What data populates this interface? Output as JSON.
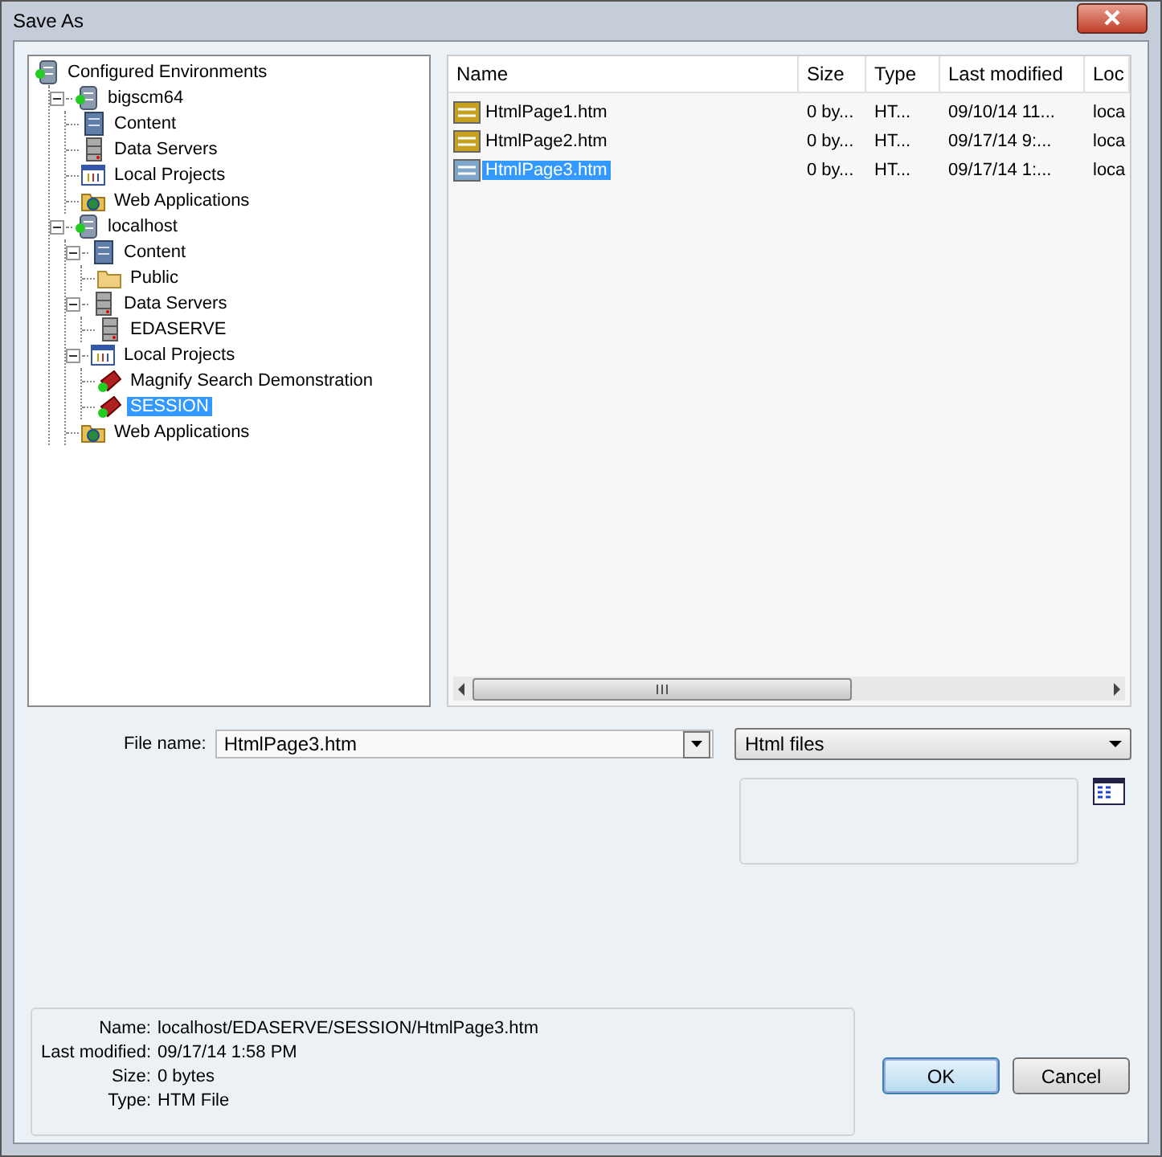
{
  "window": {
    "title": "Save As"
  },
  "tree": [
    {
      "label": "Configured Environments",
      "kind": "environments",
      "selected": false,
      "children": [
        {
          "label": "bigscm64",
          "kind": "server",
          "selected": false,
          "expanded": true,
          "children": [
            {
              "label": "Content",
              "kind": "content",
              "selected": false
            },
            {
              "label": "Data Servers",
              "kind": "dataservers",
              "selected": false
            },
            {
              "label": "Local Projects",
              "kind": "projects",
              "selected": false
            },
            {
              "label": "Web Applications",
              "kind": "webapps",
              "selected": false
            }
          ]
        },
        {
          "label": "localhost",
          "kind": "server",
          "selected": false,
          "expanded": true,
          "children": [
            {
              "label": "Content",
              "kind": "content",
              "selected": false,
              "expanded": true,
              "children": [
                {
                  "label": "Public",
                  "kind": "folder",
                  "selected": false
                }
              ]
            },
            {
              "label": "Data Servers",
              "kind": "dataservers",
              "selected": false,
              "expanded": true,
              "children": [
                {
                  "label": "EDASERVE",
                  "kind": "dataserver",
                  "selected": false
                }
              ]
            },
            {
              "label": "Local Projects",
              "kind": "projects",
              "selected": false,
              "expanded": true,
              "children": [
                {
                  "label": "Magnify Search Demonstration",
                  "kind": "project",
                  "selected": false
                },
                {
                  "label": "SESSION",
                  "kind": "project",
                  "selected": true
                }
              ]
            },
            {
              "label": "Web Applications",
              "kind": "webapps",
              "selected": false
            }
          ]
        }
      ]
    }
  ],
  "files": {
    "columns": [
      "Name",
      "Size",
      "Type",
      "Last modified",
      "Loc"
    ],
    "rows": [
      {
        "cells": [
          "HtmlPage1.htm",
          "0 by...",
          "HT...",
          "09/10/14 11...",
          "loca"
        ],
        "selected": false
      },
      {
        "cells": [
          "HtmlPage2.htm",
          "0 by...",
          "HT...",
          "09/17/14 9:...",
          "loca"
        ],
        "selected": false
      },
      {
        "cells": [
          "HtmlPage3.htm",
          "0 by...",
          "HT...",
          "09/17/14 1:...",
          "loca"
        ],
        "selected": true
      }
    ]
  },
  "file_name": {
    "label": "File name:",
    "value": "HtmlPage3.htm"
  },
  "file_type": {
    "value": "Html files"
  },
  "info": [
    {
      "label": "Name:",
      "value": "localhost/EDASERVE/SESSION/HtmlPage3.htm"
    },
    {
      "label": "Last modified:",
      "value": "09/17/14 1:58 PM"
    },
    {
      "label": "Size:",
      "value": "0 bytes"
    },
    {
      "label": "Type:",
      "value": "HTM File"
    }
  ],
  "buttons": [
    {
      "label": "OK",
      "kind": "default"
    },
    {
      "label": "Cancel",
      "kind": "normal"
    }
  ]
}
